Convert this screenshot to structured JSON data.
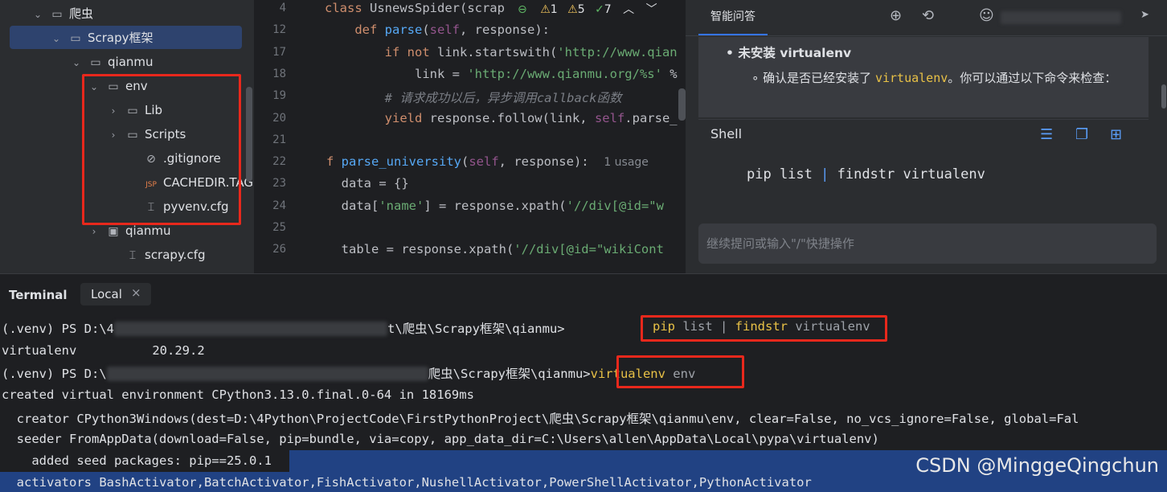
{
  "tree": {
    "items": [
      {
        "label": "爬虫",
        "chev": "⌄",
        "icon": "folder"
      },
      {
        "label": "Scrapy框架",
        "chev": "⌄",
        "icon": "folder"
      },
      {
        "label": "qianmu",
        "chev": "⌄",
        "icon": "folder"
      },
      {
        "label": "env",
        "chev": "⌄",
        "icon": "folder"
      },
      {
        "label": "Lib",
        "chev": "›",
        "icon": "folder"
      },
      {
        "label": "Scripts",
        "chev": "›",
        "icon": "folder"
      },
      {
        "label": ".gitignore",
        "chev": "",
        "icon": "ignore-file"
      },
      {
        "label": "CACHEDIR.TAG",
        "chev": "",
        "icon": "jsp-file"
      },
      {
        "label": "pyvenv.cfg",
        "chev": "",
        "icon": "config-file"
      },
      {
        "label": "qianmu",
        "chev": "›",
        "icon": "module-folder"
      },
      {
        "label": "scrapy.cfg",
        "chev": "",
        "icon": "config-file"
      }
    ]
  },
  "editor": {
    "inspection": {
      "warn": "1",
      "weak": "5",
      "ok": "7"
    },
    "usage_hint": "1 usage",
    "lines": [
      {
        "num": "4",
        "tokens": [
          [
            "kw",
            "class "
          ],
          [
            "",
            "UsnewsSpider(scrap"
          ]
        ]
      },
      {
        "num": "12",
        "tokens": [
          [
            "kw",
            "    def "
          ],
          [
            "fn",
            "parse"
          ],
          [
            "",
            "("
          ],
          [
            "self",
            "self"
          ],
          [
            "",
            ", response):"
          ]
        ]
      },
      {
        "num": "17",
        "tokens": [
          [
            "kw",
            "        if not "
          ],
          [
            "",
            "link.startswith("
          ],
          [
            "str",
            "'http://www.qian"
          ]
        ]
      },
      {
        "num": "18",
        "tokens": [
          [
            "",
            "            link = "
          ],
          [
            "str",
            "'http://www.qianmu.org/%s'"
          ],
          [
            "",
            " %"
          ]
        ]
      },
      {
        "num": "19",
        "tokens": [
          [
            "cm",
            "        # 请求成功以后，异步调用callback函数"
          ]
        ]
      },
      {
        "num": "20",
        "tokens": [
          [
            "kw",
            "        yield "
          ],
          [
            "",
            "response.follow(link, "
          ],
          [
            "self",
            "self"
          ],
          [
            "",
            ".parse_"
          ]
        ]
      },
      {
        "num": "21",
        "tokens": []
      },
      {
        "num": "22",
        "tokens": [
          [
            "kw",
            "f "
          ],
          [
            "fn",
            "parse_university"
          ],
          [
            "",
            "("
          ],
          [
            "self",
            "self"
          ],
          [
            "",
            ", response):  "
          ]
        ]
      },
      {
        "num": "23",
        "tokens": [
          [
            "",
            "  data = {}"
          ]
        ]
      },
      {
        "num": "24",
        "tokens": [
          [
            "",
            "  data["
          ],
          [
            "str",
            "'name'"
          ],
          [
            "",
            "] = response.xpath("
          ],
          [
            "str",
            "'//div[@id=\"w"
          ]
        ]
      },
      {
        "num": "25",
        "tokens": []
      },
      {
        "num": "26",
        "tokens": [
          [
            "",
            "  table = response.xpath("
          ],
          [
            "str",
            "'//div[@id=\"wikiCont"
          ]
        ]
      }
    ]
  },
  "ai": {
    "tab_label": "智能问答",
    "bullet_title": "未安装 virtualenv",
    "sub_text_before": "确认是否已经安装了 ",
    "sub_code": "virtualenv",
    "sub_text_after": "。你可以通过以下命令来检查：",
    "code_lang": "Shell",
    "code_cmd_a": "pip list ",
    "code_pipe": "|",
    "code_cmd_b": " findstr virtualenv",
    "input_placeholder": "继续提问或输入\"/\"快捷操作"
  },
  "terminal": {
    "tab_terminal": "Terminal",
    "tab_local": "Local",
    "prompt1_start": "(.venv) PS D:\\4",
    "prompt1_end": "t\\爬虫\\Scrapy框架\\qianmu>",
    "cmd1_a": "pip",
    "cmd1_b": " list | ",
    "cmd1_c": "findstr",
    "cmd1_d": " virtualenv",
    "out_name": "virtualenv",
    "out_version": "20.29.2",
    "prompt2_start": "(.venv) PS D:\\",
    "prompt2_end": "爬虫\\Scrapy框架\\qianmu>",
    "cmd2_a": "virtualenv",
    "cmd2_b": " env",
    "line5": "created virtual environment CPython3.13.0.final.0-64 in 18169ms",
    "line6": "  creator CPython3Windows(dest=D:\\4Python\\ProjectCode\\FirstPythonProject\\爬虫\\Scrapy框架\\qianmu\\env, clear=False, no_vcs_ignore=False, global=Fal",
    "line7": "  seeder FromAppData(download=False, pip=bundle, via=copy, app_data_dir=C:\\Users\\allen\\AppData\\Local\\pypa\\virtualenv)",
    "line8": "    added seed packages: pip==25.0.1",
    "line9": "  activators BashActivator,BatchActivator,FishActivator,NushellActivator,PowerShellActivator,PythonActivator",
    "watermark": "CSDN @MinggeQingchun"
  }
}
